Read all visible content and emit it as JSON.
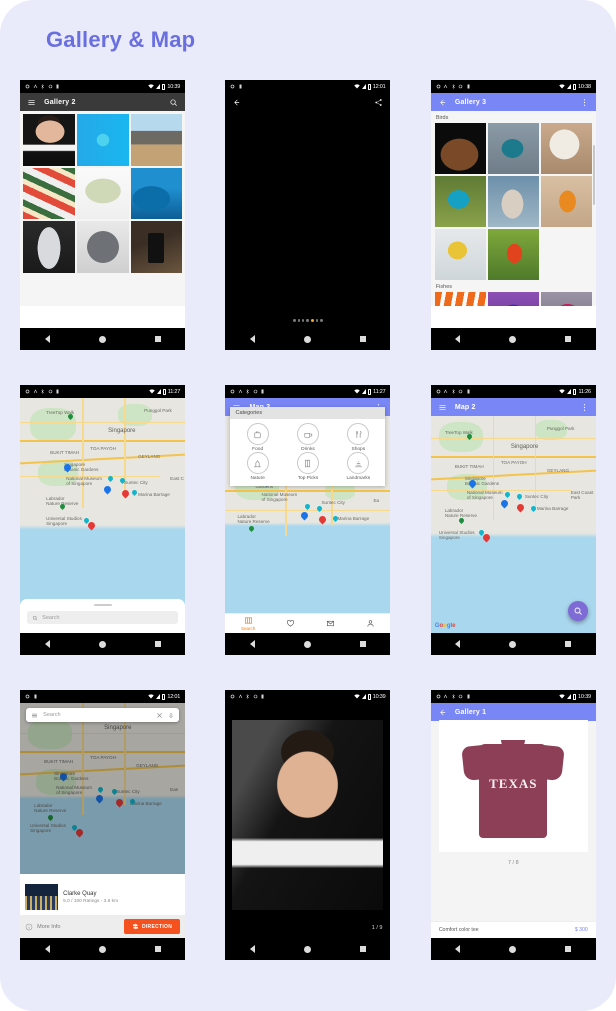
{
  "page": {
    "title": "Gallery & Map",
    "bg": "#e9ebfa",
    "title_color": "#6a6fe0"
  },
  "phones": [
    {
      "id": "gallery-2",
      "kind": "gallery-grid",
      "status": {
        "time": "10:39"
      },
      "toolbar": {
        "title": "Gallery 2",
        "style": "dark",
        "left_icon": "hamburger-icon",
        "right_icon": "search-icon"
      },
      "tiles": [
        "t-musk",
        "t-blue",
        "t-field",
        "t-cars",
        "t-money",
        "t-reef",
        "t-speaker",
        "t-mini",
        "t-phone"
      ]
    },
    {
      "id": "photo-viewer-castle",
      "kind": "viewer-castle",
      "status": {
        "time": "12:01"
      },
      "toolbar": {
        "left_icon": "back-arrow-icon",
        "right_icon": "share-icon"
      },
      "dots": {
        "count": 7,
        "active_index": 4
      }
    },
    {
      "id": "gallery-3",
      "kind": "gallery-sections",
      "status": {
        "time": "10:38"
      },
      "toolbar": {
        "title": "Gallery 3",
        "style": "purple",
        "left_icon": "back-arrow-icon",
        "right_icon": "overflow-menu-icon"
      },
      "sections": [
        {
          "label": "Birds",
          "tiles": [
            "t-duck",
            "t-humm",
            "t-fluff",
            "t-gould",
            "t-falcon",
            "t-king",
            "t-yellow",
            "t-painted"
          ]
        },
        {
          "label": "Fishes",
          "tiles": [
            "t-clown",
            "t-blufish",
            "t-betta"
          ]
        }
      ]
    },
    {
      "id": "map-search-sheet",
      "kind": "map-sheet",
      "status": {
        "time": "11:27"
      },
      "search": {
        "placeholder": "Search",
        "value": "",
        "icon": "search-icon"
      },
      "map": {
        "city_label": "Singapore"
      }
    },
    {
      "id": "map-3",
      "kind": "map-categories",
      "status": {
        "time": "11:27"
      },
      "toolbar": {
        "title": "Map 3",
        "style": "purple",
        "left_icon": "hamburger-icon",
        "right_icon": "overflow-menu-icon"
      },
      "categories": {
        "header": "Categories",
        "items": [
          {
            "label": "Food",
            "icon": "food-icon"
          },
          {
            "label": "Drinks",
            "icon": "drinks-cup-icon"
          },
          {
            "label": "Shops",
            "icon": "cutlery-icon"
          },
          {
            "label": "Nature",
            "icon": "nature-icon"
          },
          {
            "label": "Top Picks",
            "icon": "building-icon"
          },
          {
            "label": "Landmarks",
            "icon": "landmark-icon"
          }
        ]
      },
      "tabs": [
        {
          "label": "Search",
          "icon": "map-icon",
          "active": true
        },
        {
          "label": "",
          "icon": "heart-icon",
          "active": false
        },
        {
          "label": "",
          "icon": "mail-icon",
          "active": false
        },
        {
          "label": "",
          "icon": "person-icon",
          "active": false
        }
      ]
    },
    {
      "id": "map-2",
      "kind": "map-fab",
      "status": {
        "time": "11:26"
      },
      "toolbar": {
        "title": "Map 2",
        "style": "purple",
        "left_icon": "hamburger-icon",
        "right_icon": "overflow-menu-icon"
      },
      "fab": {
        "icon": "search-icon",
        "color": "#7e6bd6"
      },
      "attribution": "Google"
    },
    {
      "id": "map-place-card",
      "kind": "map-place",
      "status": {
        "time": "12:01"
      },
      "search": {
        "placeholder": "Search",
        "left_icon": "hamburger-icon",
        "clear_icon": "close-icon",
        "mic_icon": "mic-icon"
      },
      "place": {
        "title": "Clarke Quay",
        "subtitle": "5.0 / 100 Ratings  -  3.6 km",
        "more_info": "More Info",
        "direction_button": "DIRECTION",
        "direction_color": "#f4511e"
      }
    },
    {
      "id": "photo-viewer-portrait",
      "kind": "viewer-portrait",
      "status": {
        "time": "10:39"
      },
      "counter": "1 / 9"
    },
    {
      "id": "gallery-1",
      "kind": "product-gallery",
      "status": {
        "time": "10:39"
      },
      "toolbar": {
        "title": "Gallery 1",
        "style": "purple",
        "left_icon": "back-arrow-icon"
      },
      "product": {
        "graphic_text": "TEXAS",
        "counter": "7 / 8",
        "name": "Comfort color tee",
        "price": "$ 300"
      }
    }
  ]
}
